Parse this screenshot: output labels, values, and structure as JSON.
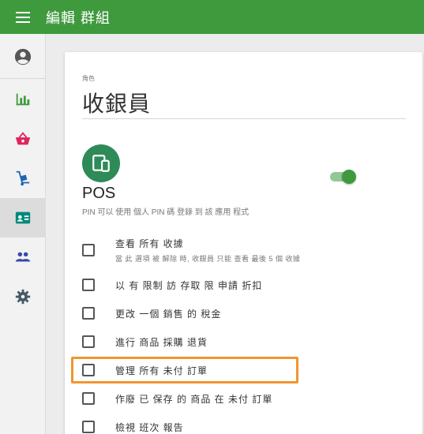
{
  "header": {
    "title": "編輯 群組",
    "menu_icon": "hamburger-menu-icon",
    "bg_color": "#3f9a3e"
  },
  "sidebar": {
    "items": [
      {
        "icon": "account-circle-icon",
        "color": "#555555",
        "active": false
      },
      {
        "icon": "bar-chart-icon",
        "color": "#3f9a3e",
        "active": false
      },
      {
        "icon": "shopping-basket-icon",
        "color": "#e0245e",
        "active": false
      },
      {
        "icon": "hand-truck-icon",
        "color": "#1e63b5",
        "active": false
      },
      {
        "icon": "contact-card-icon",
        "color": "#00897b",
        "active": true
      },
      {
        "icon": "people-icon",
        "color": "#3949ab",
        "active": false
      },
      {
        "icon": "settings-gear-icon",
        "color": "#455a64",
        "active": false
      }
    ]
  },
  "role": {
    "label": "角色",
    "value": "收銀員"
  },
  "pos": {
    "title": "POS",
    "subtitle": "PIN 可以 使用 個人 PIN 碼 登錄 到 該 應用 程式",
    "icon": "devices-icon",
    "enabled": true,
    "accent": "#2e8b57"
  },
  "permissions": [
    {
      "label": "查看 所有 收據",
      "description": "當 此 選項 被 解除 時, 收銀員 只能 查看 最後 5 個 收據",
      "checked": false
    },
    {
      "label": "以 有 限制 訪 存取 限 申請 折扣",
      "description": "",
      "checked": false
    },
    {
      "label": "更改 一個 銷售 的 稅金",
      "description": "",
      "checked": false
    },
    {
      "label": "進行 商品 採購 退貨",
      "description": "",
      "checked": false
    },
    {
      "label": "管理 所有 未付 訂單",
      "description": "",
      "checked": false,
      "highlighted": true
    },
    {
      "label": "作廢 已 保存 的 商品 在 未付 訂單",
      "description": "",
      "checked": false
    },
    {
      "label": "檢視 班次 報告",
      "description": "",
      "checked": false
    }
  ],
  "highlight_color": "#f0962e"
}
